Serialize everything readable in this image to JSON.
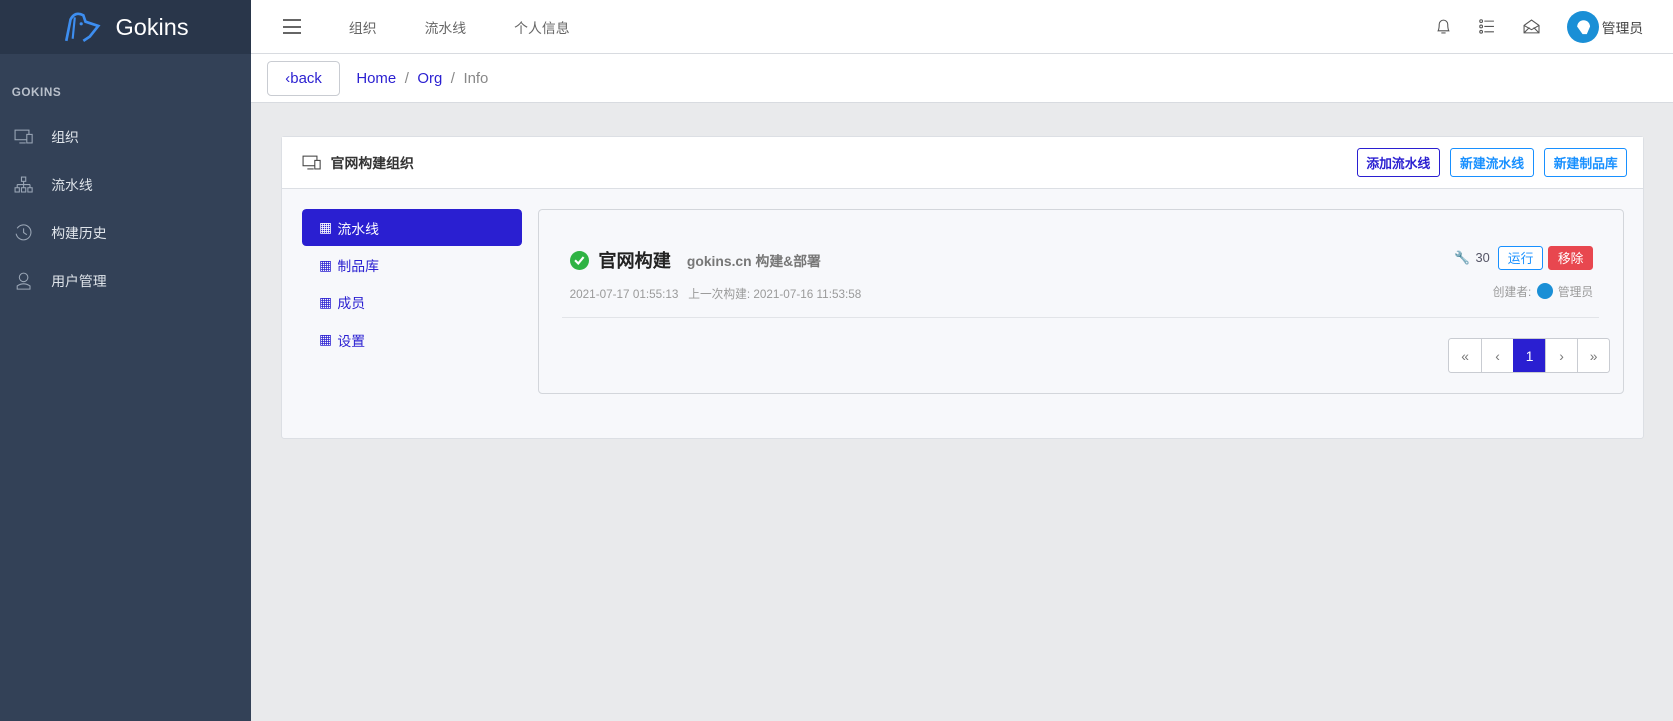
{
  "brand": {
    "name": "Gokins"
  },
  "sidebar": {
    "section": "GOKINS",
    "items": [
      {
        "label": "组织",
        "icon": "monitor-icon"
      },
      {
        "label": "流水线",
        "icon": "sitemap-icon"
      },
      {
        "label": "构建历史",
        "icon": "history-icon"
      },
      {
        "label": "用户管理",
        "icon": "user-icon"
      }
    ]
  },
  "topbar": {
    "nav": [
      "组织",
      "流水线",
      "个人信息"
    ],
    "user": "管理员"
  },
  "breadcrumb": {
    "back": "back",
    "items": [
      "Home",
      "Org",
      "Info"
    ],
    "sep": "/"
  },
  "org": {
    "title": "官网构建组织",
    "buttons": [
      "添加流水线",
      "新建流水线",
      "新建制品库"
    ],
    "menu": [
      "流水线",
      "制品库",
      "成员",
      "设置"
    ],
    "pipeline": {
      "name": "官网构建",
      "desc": "gokins.cn 构建&部署",
      "created": "2021-07-17 01:55:13",
      "last_build": "上一次构建: 2021-07-16 11:53:58",
      "build_count": "30",
      "run": "运行",
      "remove": "移除",
      "creator_label": "创建者:",
      "creator": "管理员"
    },
    "pager": [
      "«",
      "‹",
      "1",
      "›",
      "»"
    ]
  },
  "colors": {
    "accent": "#2a1fd1",
    "sidebar": "#334157",
    "danger": "#e8474f",
    "success": "#2fb344"
  }
}
